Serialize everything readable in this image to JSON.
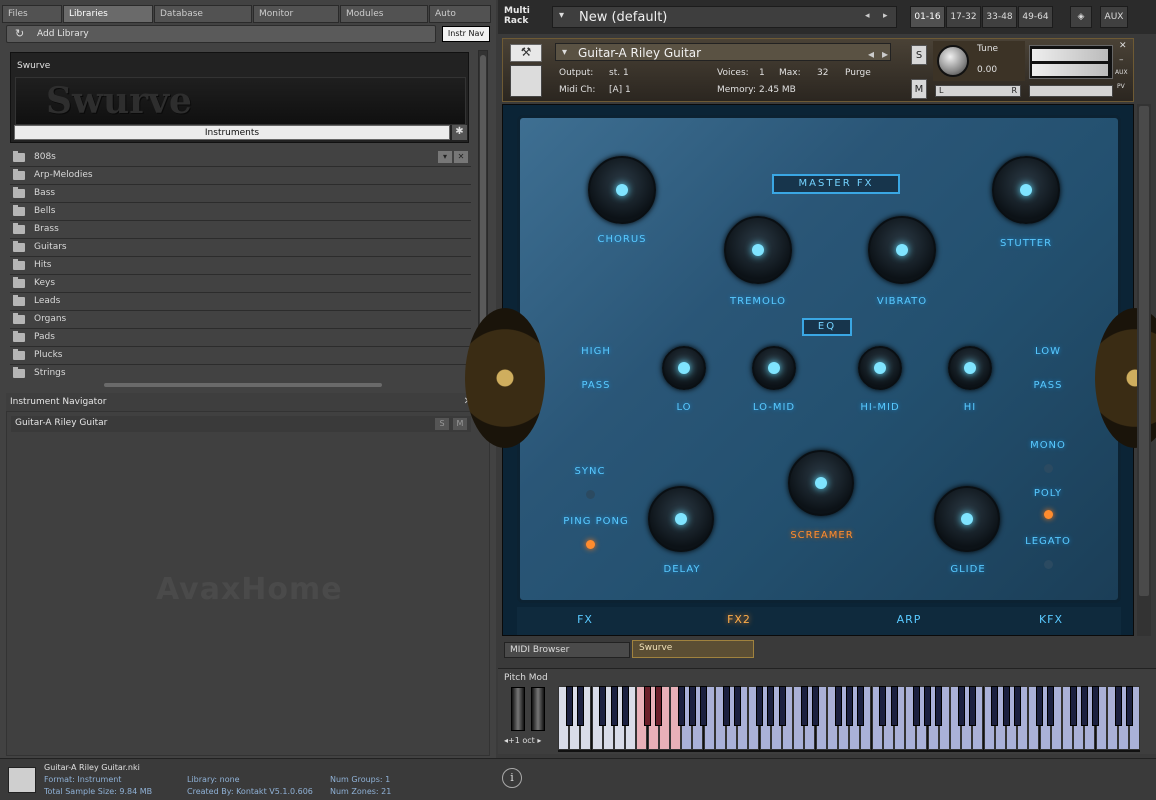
{
  "browser": {
    "tabs": [
      "Files",
      "Libraries",
      "Database",
      "Monitor",
      "Modules",
      "Auto"
    ],
    "add_library": "Add Library",
    "instr_nav": "Instr Nav",
    "library_name": "Swurve",
    "library_logo_text": "Swurve",
    "instruments_button": "Instruments",
    "folders": [
      "808s",
      "Arp-Melodies",
      "Bass",
      "Bells",
      "Brass",
      "Guitars",
      "Hits",
      "Keys",
      "Leads",
      "Organs",
      "Pads",
      "Plucks",
      "Strings"
    ]
  },
  "navigator": {
    "title": "Instrument Navigator",
    "item": "Guitar-A Riley Guitar",
    "s": "S",
    "m": "M"
  },
  "watermark": "AvaxHome",
  "rack": {
    "label_line1": "Multi",
    "label_line2": "Rack",
    "name": "New (default)",
    "pages": [
      "01-16",
      "17-32",
      "33-48",
      "49-64"
    ],
    "aux": "AUX"
  },
  "instrument": {
    "name": "Guitar-A Riley Guitar",
    "output_label": "Output:",
    "output_value": "st. 1",
    "voices_label": "Voices:",
    "voices_value": "1",
    "max_label": "Max:",
    "max_value": "32",
    "purge": "Purge",
    "midi_label": "Midi Ch:",
    "midi_value": "[A]  1",
    "memory_label": "Memory:",
    "memory_value": "2.45 MB",
    "tune_label": "Tune",
    "tune_value": "0.00",
    "s": "S",
    "m": "M",
    "pan_l": "L",
    "pan_r": "R",
    "aux": "AUX",
    "pv": "PV"
  },
  "fx": {
    "master": "MASTER FX",
    "eq": "EQ",
    "chorus": "CHORUS",
    "tremolo": "TREMOLO",
    "vibrato": "VIBRATO",
    "stutter": "STUTTER",
    "high": "HIGH",
    "pass": "PASS",
    "low": "LOW",
    "lo": "LO",
    "lomid": "LO-MID",
    "himid": "HI-MID",
    "hi": "HI",
    "sync": "SYNC",
    "pingpong": "PING PONG",
    "delay": "DELAY",
    "screamer": "SCREAMER",
    "glide": "GLIDE",
    "mono": "MONO",
    "poly": "POLY",
    "legato": "LEGATO",
    "tabs": [
      "FX",
      "FX2",
      "ARP",
      "KFX"
    ],
    "active_tab": "FX2"
  },
  "bottom_tabs": {
    "midi_browser": "MIDI Browser",
    "swurve": "Swurve"
  },
  "keyboard": {
    "pitch_mod": "Pitch Mod",
    "octave": "◂+1 oct ▸"
  },
  "status": {
    "file": "Guitar-A Riley Guitar.nki",
    "format": "Format: Instrument",
    "size": "Total Sample Size: 9.84 MB",
    "library": "Library: none",
    "created": "Created By: Kontakt V5.1.0.606",
    "groups": "Num Groups: 1",
    "zones": "Num Zones: 21",
    "info": "i"
  },
  "colors": {
    "accent_blue": "#59c9ff",
    "accent_orange": "#ff8c2e"
  }
}
